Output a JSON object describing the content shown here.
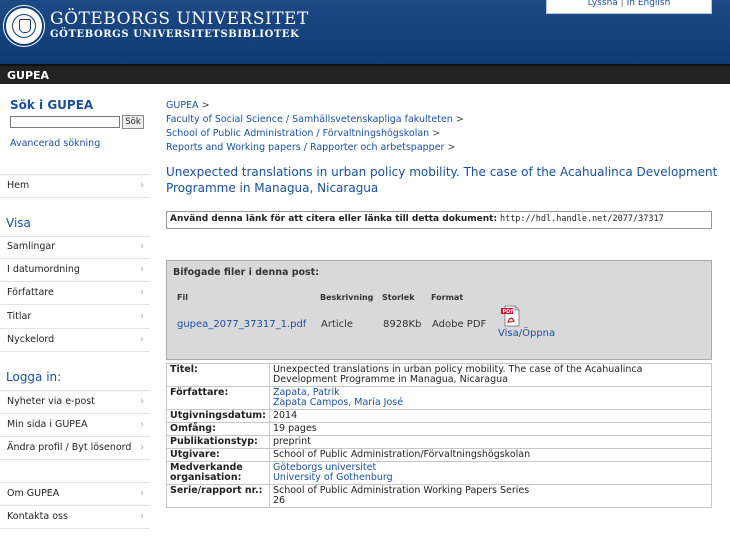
{
  "header": {
    "university": "GÖTEBORGS UNIVERSITET",
    "library": "GÖTEBORGS UNIVERSITETSBIBLIOTEK",
    "listen_link": "Lyssna",
    "separator": "|",
    "english_link": "In English"
  },
  "bar": {
    "title": "GUPEA"
  },
  "sidebar": {
    "search_title": "Sök i GUPEA",
    "search_input_value": "",
    "search_button": "Sök",
    "advanced": "Avancerad sökning",
    "home": "Hem",
    "visa_heading": "Visa",
    "visa_items": [
      "Samlingar",
      "I datumordning",
      "Författare",
      "Titlar",
      "Nyckelord"
    ],
    "login_heading": "Logga in:",
    "login_items": [
      "Nyheter via e-post",
      "Min sida i GUPEA",
      "Ändra profil / Byt lösenord"
    ],
    "bottom_items": [
      "Om GUPEA",
      "Kontakta oss"
    ],
    "chevron": "›"
  },
  "breadcrumbs": [
    "GUPEA",
    "Faculty of Social Science / Samhällsvetenskapliga fakulteten",
    "School of Public Administration / Förvaltningshögskolan",
    "Reports and Working papers / Rapporter och arbetspapper"
  ],
  "breadcrumb_sep": ">",
  "item": {
    "title": "Unexpected translations in urban policy mobility. The case of the Acahualinca Development Programme in Managua, Nicaragua",
    "cite_label": "Använd denna länk för att citera eller länka till detta dokument:",
    "cite_url": "http://hdl.handle.net/2077/37317"
  },
  "files": {
    "heading": "Bifogade filer i denna post:",
    "columns": [
      "Fil",
      "Beskrivning",
      "Storlek",
      "Format"
    ],
    "row": {
      "file": "gupea_2077_37317_1.pdf",
      "description": "Article",
      "size": "8928Kb",
      "format": "Adobe PDF",
      "view": "Visa/Öppna"
    },
    "icon_text": "PDF"
  },
  "metadata": [
    {
      "key": "Titel:",
      "values": [
        "Unexpected translations in urban policy mobility. The case of the Acahualinca Development Programme in Managua, Nicaragua"
      ],
      "link": false
    },
    {
      "key": "Författare:",
      "values": [
        "Zapata, Patrik",
        "Zapata Campos, María José"
      ],
      "link": true
    },
    {
      "key": "Utgivningsdatum:",
      "values": [
        "2014"
      ],
      "link": false
    },
    {
      "key": "Omfång:",
      "values": [
        "19 pages"
      ],
      "link": false
    },
    {
      "key": "Publikationstyp:",
      "values": [
        "preprint"
      ],
      "link": false
    },
    {
      "key": "Utgivare:",
      "values": [
        "School of Public Administration/Förvaltningshögskolan"
      ],
      "link": false
    },
    {
      "key": "Medverkande organisation:",
      "values": [
        "Göteborgs universitet",
        "University of Gothenburg"
      ],
      "link": true
    },
    {
      "key": "Serie/rapport nr.:",
      "values": [
        "School of Public Administration Working Papers Series",
        "26"
      ],
      "link": false
    }
  ],
  "colors": {
    "brand": "#0f3a74",
    "link": "#1a4f9c",
    "bar": "#222222"
  }
}
